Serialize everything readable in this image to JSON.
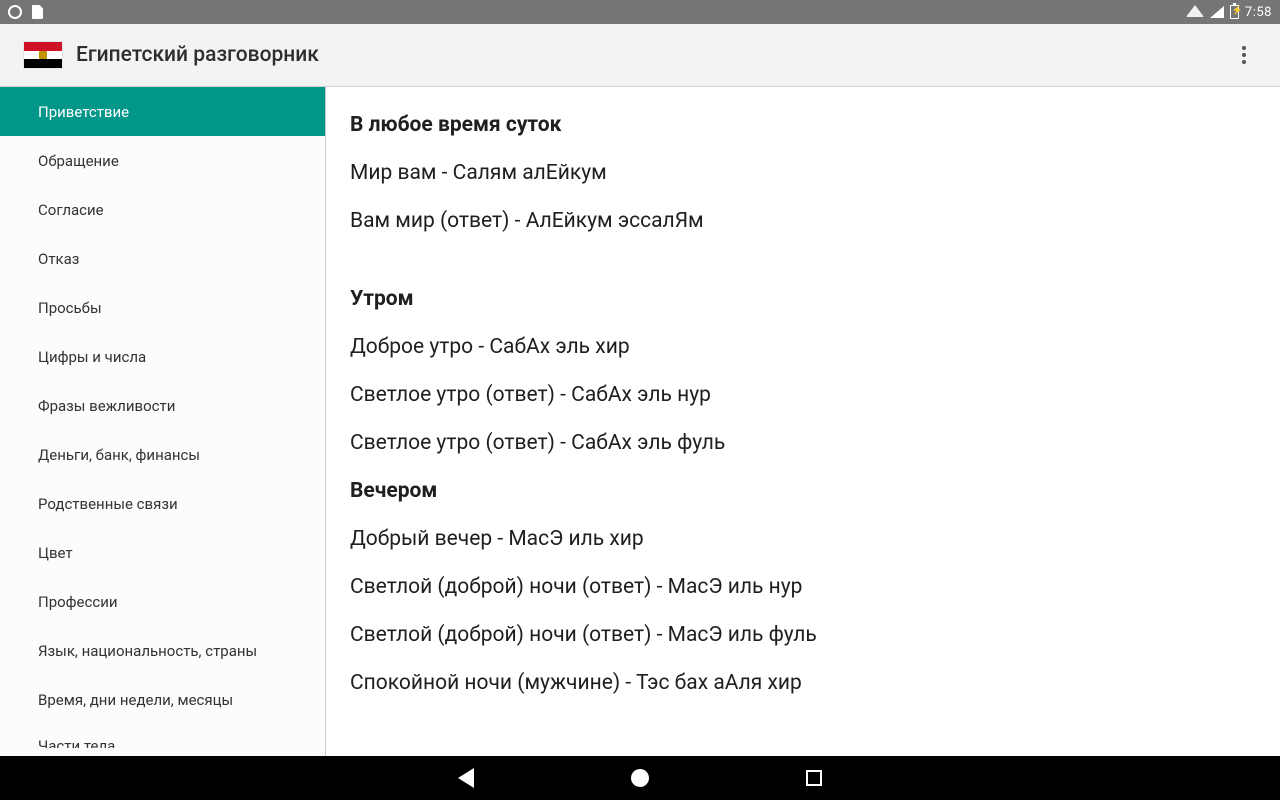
{
  "status": {
    "time": "7:58"
  },
  "app": {
    "title": "Египетский разговорник"
  },
  "sidebar": {
    "items": [
      {
        "label": "Приветствие",
        "selected": true
      },
      {
        "label": "Обращение",
        "selected": false
      },
      {
        "label": "Согласие",
        "selected": false
      },
      {
        "label": "Отказ",
        "selected": false
      },
      {
        "label": "Просьбы",
        "selected": false
      },
      {
        "label": "Цифры и числа",
        "selected": false
      },
      {
        "label": "Фразы вежливости",
        "selected": false
      },
      {
        "label": "Деньги, банк, финансы",
        "selected": false
      },
      {
        "label": "Родственные связи",
        "selected": false
      },
      {
        "label": "Цвет",
        "selected": false
      },
      {
        "label": "Профессии",
        "selected": false
      },
      {
        "label": "Язык, национальность, страны",
        "selected": false
      },
      {
        "label": "Время, дни недели, месяцы",
        "selected": false
      },
      {
        "label": "Части тела",
        "selected": false
      }
    ]
  },
  "content": {
    "blocks": [
      {
        "type": "title",
        "text": "В любое время суток"
      },
      {
        "type": "phrase",
        "text": "Мир вам - Салям алЕйкум"
      },
      {
        "type": "phrase",
        "text": "Вам мир (ответ) - АлЕйкум эссалЯм"
      },
      {
        "type": "gap"
      },
      {
        "type": "title",
        "text": "Утром"
      },
      {
        "type": "phrase",
        "text": "Доброе утро - СабАх эль хир"
      },
      {
        "type": "phrase",
        "text": "Светлое утро (ответ) - СабАх эль нур"
      },
      {
        "type": "phrase",
        "text": "Светлое утро (ответ) - СабАх эль фуль"
      },
      {
        "type": "title",
        "text": "Вечером"
      },
      {
        "type": "phrase",
        "text": "Добрый вечер - МасЭ иль хир"
      },
      {
        "type": "phrase",
        "text": "Светлой (доброй) ночи (ответ) - МасЭ иль нур"
      },
      {
        "type": "phrase",
        "text": "Светлой (доброй) ночи (ответ) - МасЭ иль фуль"
      },
      {
        "type": "phrase",
        "text": "Спокойной ночи (мужчине) - Тэс бах аАля хир"
      }
    ]
  }
}
